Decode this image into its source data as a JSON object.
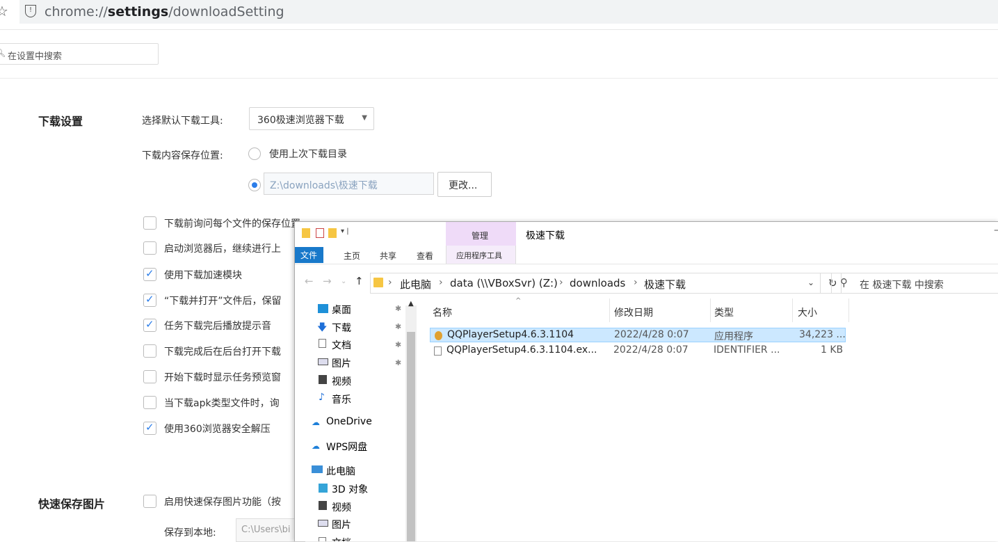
{
  "browser": {
    "url_prefix": "chrome://",
    "url_bold": "settings",
    "url_suffix": "/downloadSetting"
  },
  "settings_search": {
    "placeholder": "在设置中搜索"
  },
  "download_section": {
    "title": "下载设置",
    "default_tool_label": "选择默认下载工具:",
    "default_tool_value": "360极速浏览器下载",
    "save_location_label": "下载内容保存位置:",
    "use_last_dir": "使用上次下载目录",
    "path_value": "Z:\\downloads\\极速下载",
    "change_button": "更改...",
    "options": [
      {
        "label": "下载前询问每个文件的保存位置",
        "checked": false
      },
      {
        "label": "启动浏览器后，继续进行上",
        "checked": false
      },
      {
        "label": "使用下载加速模块",
        "checked": true
      },
      {
        "label": "“下载并打开”文件后，保留",
        "checked": true
      },
      {
        "label": "任务下载完后播放提示音",
        "checked": true
      },
      {
        "label": "下载完成后在后台打开下载",
        "checked": false
      },
      {
        "label": "开始下载时显示任务预览窗",
        "checked": false
      },
      {
        "label": "当下载apk类型文件时，询",
        "checked": false
      },
      {
        "label": "使用360浏览器安全解压",
        "checked": true
      }
    ]
  },
  "quick_save_section": {
    "title": "快速保存图片",
    "enable_label": "启用快速保存图片功能（按",
    "save_local_label": "保存到本地:",
    "save_local_value": "C:\\Users\\bi"
  },
  "explorer": {
    "window_title": "极速下载",
    "manage_tab": "管理",
    "app_tools_tab": "应用程序工具",
    "ribbon_tabs": [
      "文件",
      "主页",
      "共享",
      "查看"
    ],
    "breadcrumb": [
      "此电脑",
      "data (\\\\VBoxSvr) (Z:)",
      "downloads",
      "极速下载"
    ],
    "search_placeholder": "在 极速下载 中搜索",
    "nav_items": [
      "桌面",
      "下载",
      "文档",
      "图片",
      "视频",
      "音乐",
      "OneDrive",
      "WPS网盘",
      "此电脑",
      "3D 对象",
      "视频",
      "图片",
      "文档"
    ],
    "columns": [
      "名称",
      "修改日期",
      "类型",
      "大小"
    ],
    "files": [
      {
        "name": "QQPlayerSetup4.6.3.1104",
        "date": "2022/4/28 0:07",
        "type": "应用程序",
        "size": "34,223 ...",
        "selected": true
      },
      {
        "name": "QQPlayerSetup4.6.3.1104.ex...",
        "date": "2022/4/28 0:07",
        "type": "IDENTIFIER ...",
        "size": "1 KB",
        "selected": false
      }
    ],
    "colors": {
      "file_tab": "#1979ca",
      "manage": "#efdbf8",
      "selection": "#cce8ff"
    }
  }
}
